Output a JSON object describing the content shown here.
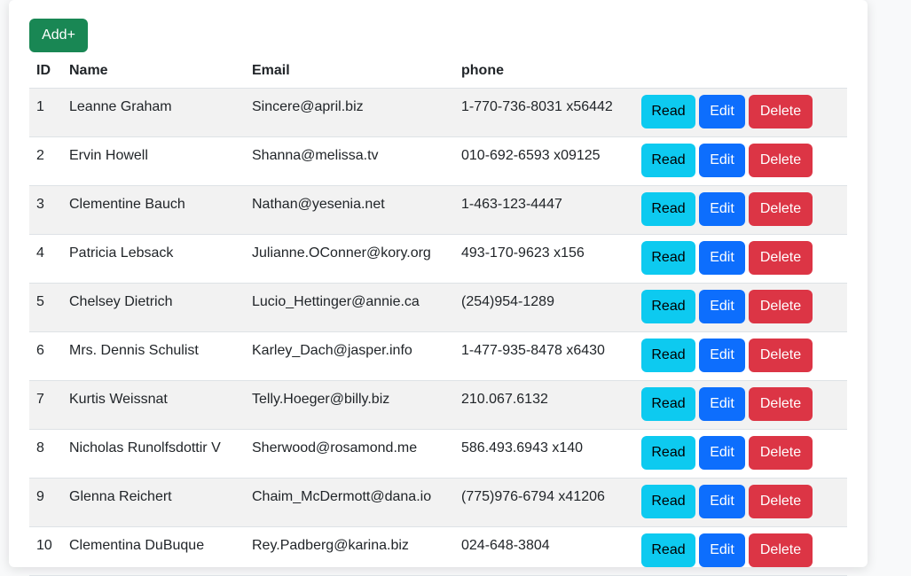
{
  "toolbar": {
    "add_label": "Add+"
  },
  "table": {
    "headers": [
      "ID",
      "Name",
      "Email",
      "phone",
      ""
    ],
    "action_labels": {
      "read": "Read",
      "edit": "Edit",
      "delete": "Delete"
    },
    "rows": [
      {
        "id": "1",
        "name": "Leanne Graham",
        "email": "Sincere@april.biz",
        "phone": "1-770-736-8031 x56442"
      },
      {
        "id": "2",
        "name": "Ervin Howell",
        "email": "Shanna@melissa.tv",
        "phone": "010-692-6593 x09125"
      },
      {
        "id": "3",
        "name": "Clementine Bauch",
        "email": "Nathan@yesenia.net",
        "phone": "1-463-123-4447"
      },
      {
        "id": "4",
        "name": "Patricia Lebsack",
        "email": "Julianne.OConner@kory.org",
        "phone": "493-170-9623 x156"
      },
      {
        "id": "5",
        "name": "Chelsey Dietrich",
        "email": "Lucio_Hettinger@annie.ca",
        "phone": "(254)954-1289"
      },
      {
        "id": "6",
        "name": "Mrs. Dennis Schulist",
        "email": "Karley_Dach@jasper.info",
        "phone": "1-477-935-8478 x6430"
      },
      {
        "id": "7",
        "name": "Kurtis Weissnat",
        "email": "Telly.Hoeger@billy.biz",
        "phone": "210.067.6132"
      },
      {
        "id": "8",
        "name": "Nicholas Runolfsdottir V",
        "email": "Sherwood@rosamond.me",
        "phone": "586.493.6943 x140"
      },
      {
        "id": "9",
        "name": "Glenna Reichert",
        "email": "Chaim_McDermott@dana.io",
        "phone": "(775)976-6794 x41206"
      },
      {
        "id": "10",
        "name": "Clementina DuBuque",
        "email": "Rey.Padberg@karina.biz",
        "phone": "024-648-3804"
      }
    ]
  },
  "colors": {
    "add": "#198754",
    "read": "#0dcaf0",
    "edit": "#0d6efd",
    "delete": "#dc3545",
    "stripe": "#f2f2f2"
  }
}
